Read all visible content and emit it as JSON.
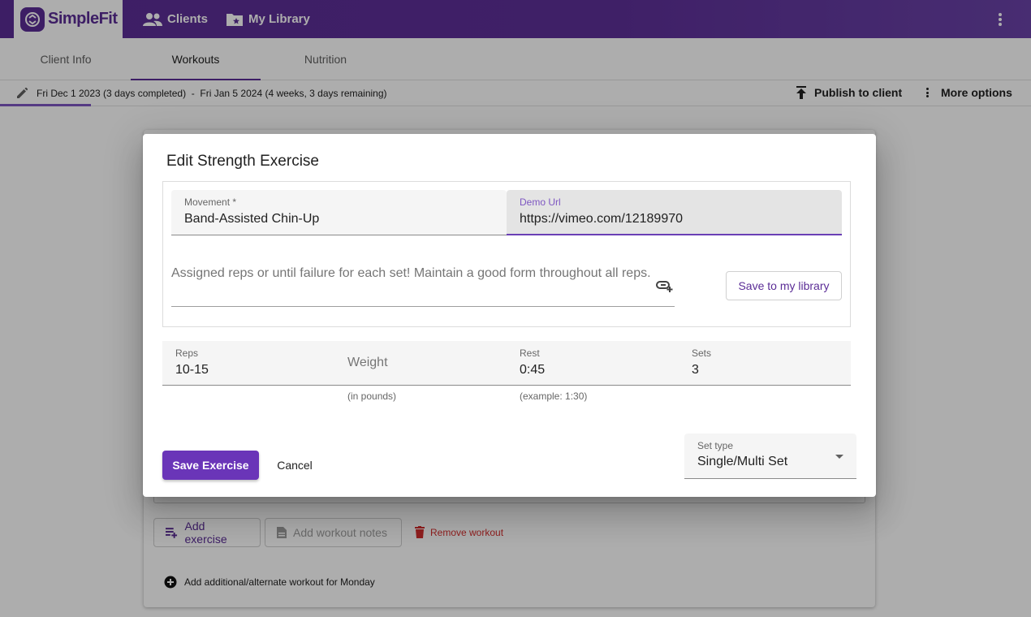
{
  "app": {
    "brand": "SimpleFit"
  },
  "nav": {
    "clients": "Clients",
    "library": "My Library"
  },
  "tabs": [
    {
      "label": "Client Info"
    },
    {
      "label": "Workouts"
    },
    {
      "label": "Nutrition"
    }
  ],
  "plan": {
    "range": "Fri Dec 1 2023 (3 days completed)  -  Fri Jan 5 2024 (4 weeks, 3 days remaining)",
    "publish": "Publish to client",
    "more": "More options"
  },
  "background": {
    "add_exercise": "Add exercise",
    "add_notes": "Add workout notes",
    "remove_workout": "Remove workout",
    "add_alternate": "Add additional/alternate workout for Monday"
  },
  "dialog": {
    "title": "Edit Strength Exercise",
    "movement": {
      "label": "Movement *",
      "value": "Band-Assisted Chin-Up"
    },
    "demo_url": {
      "label": "Demo Url",
      "value": "https://vimeo.com/12189970"
    },
    "notes": "Assigned reps or until failure for each set! Maintain a good form throughout all reps.",
    "save_library": "Save to my library",
    "reps": {
      "label": "Reps",
      "value": "10-15"
    },
    "weight": {
      "placeholder": "Weight",
      "hint": "(in pounds)"
    },
    "rest": {
      "label": "Rest",
      "value": "0:45",
      "hint": "(example: 1:30)"
    },
    "sets": {
      "label": "Sets",
      "value": "3"
    },
    "save_button": "Save Exercise",
    "cancel_button": "Cancel",
    "set_type": {
      "label": "Set type",
      "value": "Single/Multi Set"
    }
  },
  "colors": {
    "primary": "#5b2d96",
    "accent": "#6a35b8",
    "danger": "#d32f2f"
  }
}
